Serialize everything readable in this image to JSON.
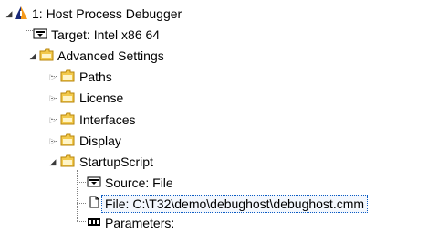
{
  "tree": {
    "root": {
      "label": "1: Host Process Debugger",
      "icon": "warning-triangle-icon"
    },
    "target": {
      "label": "Target: Intel x86 64",
      "icon": "enum-icon"
    },
    "advanced": {
      "label": "Advanced Settings",
      "icon": "folder-icon"
    },
    "paths": {
      "label": "Paths",
      "icon": "folder-icon"
    },
    "license": {
      "label": "License",
      "icon": "folder-icon"
    },
    "interfaces": {
      "label": "Interfaces",
      "icon": "folder-icon"
    },
    "display": {
      "label": "Display",
      "icon": "folder-icon"
    },
    "startup": {
      "label": "StartupScript",
      "icon": "folder-icon"
    },
    "source": {
      "label": "Source: File",
      "icon": "enum-icon"
    },
    "file": {
      "label": "File: C:\\T32\\demo\\debughost\\debughost.cmm",
      "icon": "file-icon"
    },
    "parameters": {
      "label": "Parameters:",
      "icon": "text-field-icon"
    }
  },
  "colors": {
    "folder": "#f2c94c",
    "folder_border": "#b8860b",
    "triangle_dark": "#1a2a7a",
    "triangle_light": "#f59a1b",
    "selection_border": "#0b5cc4"
  }
}
